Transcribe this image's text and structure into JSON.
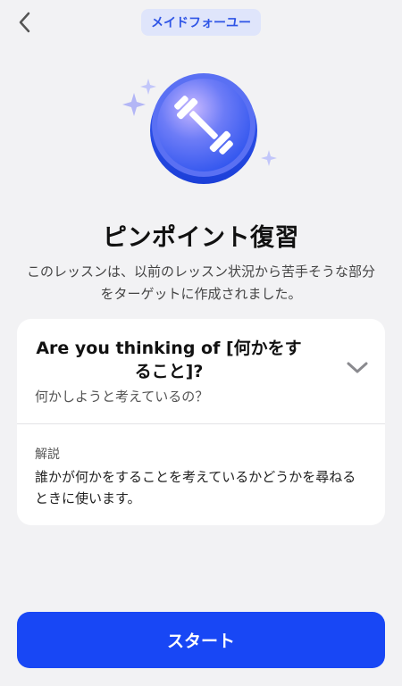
{
  "header": {
    "back_icon": "chevron-left-icon",
    "badge_label": "メイドフォーユー"
  },
  "hero": {
    "icon": "dumbbell-icon",
    "accent_color": "#3b5cf0",
    "sparkle_colors": [
      "#a9b4f7",
      "#c5c9fa"
    ]
  },
  "title": "ピンポイント復習",
  "description": "このレッスンは、以前のレッスン状況から苦手そうな部分をターゲットに作成されました。",
  "card": {
    "phrase": "Are you thinking of [何かをすること]?",
    "translation": "何かしようと考えているの？",
    "toggle_icon": "chevron-down-icon",
    "explanation_heading": "解説",
    "explanation_text": "誰かが何かをすることを考えているかどうかを尋ねるときに使います。"
  },
  "start_button_label": "スタート",
  "colors": {
    "background": "#f2f2f4",
    "primary_button": "#1847f5",
    "badge_bg": "#dfe5fb",
    "badge_text": "#2f55e6"
  }
}
